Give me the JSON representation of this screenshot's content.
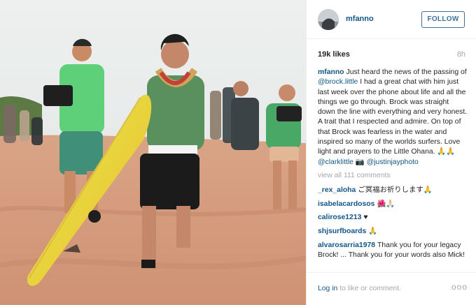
{
  "post": {
    "username": "mfanno",
    "follow_label": "FOLLOW",
    "likes": "19k likes",
    "time": "8h",
    "caption": {
      "user": "mfanno",
      "p1": "Just heard the news of the passing of ",
      "mention1": "@brock.little",
      "p2": " I had a great chat with him just last week over the phone about life and all the things we go through. Brock was straight down the line with everything and very honest. A trait that I respected and admire. On top of that Brock was fearless in the water and inspired so many of the worlds surfers. Love light and prayers to the Little Ohana. 🙏🙏 ",
      "mention2": "@clarklittle",
      "p3": " 📷",
      "mention3": "@justinjayphoto"
    },
    "view_all": "view all 111 comments",
    "comments": [
      {
        "user": "_rex_aloha",
        "text": "ご冥福お祈りします🙏"
      },
      {
        "user": "isabelacardosos",
        "text": "🌺🙏🏻"
      },
      {
        "user": "calirose1213",
        "text": "♥"
      },
      {
        "user": "shjsurfboards",
        "text": "🙏"
      },
      {
        "user": "alvarosarria1978",
        "text": "Thank you for your legacy Brock! ... Thank you for your words also Mick!"
      }
    ],
    "footer": {
      "login_link": "Log in",
      "login_rest": " to like or comment.",
      "more": "ooo"
    }
  },
  "colors": {
    "link": "#125688",
    "follow": "#3f729b",
    "muted": "#a5a7aa"
  }
}
